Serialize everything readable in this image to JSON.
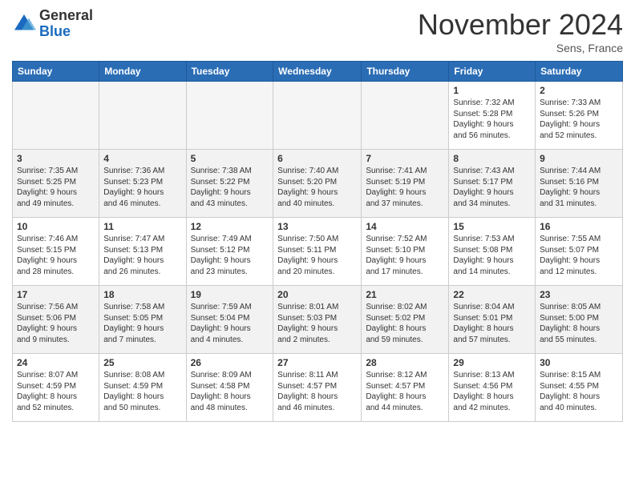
{
  "logo": {
    "general": "General",
    "blue": "Blue"
  },
  "header": {
    "month": "November 2024",
    "location": "Sens, France"
  },
  "weekdays": [
    "Sunday",
    "Monday",
    "Tuesday",
    "Wednesday",
    "Thursday",
    "Friday",
    "Saturday"
  ],
  "weeks": [
    [
      {
        "day": "",
        "info": ""
      },
      {
        "day": "",
        "info": ""
      },
      {
        "day": "",
        "info": ""
      },
      {
        "day": "",
        "info": ""
      },
      {
        "day": "",
        "info": ""
      },
      {
        "day": "1",
        "info": "Sunrise: 7:32 AM\nSunset: 5:28 PM\nDaylight: 9 hours\nand 56 minutes."
      },
      {
        "day": "2",
        "info": "Sunrise: 7:33 AM\nSunset: 5:26 PM\nDaylight: 9 hours\nand 52 minutes."
      }
    ],
    [
      {
        "day": "3",
        "info": "Sunrise: 7:35 AM\nSunset: 5:25 PM\nDaylight: 9 hours\nand 49 minutes."
      },
      {
        "day": "4",
        "info": "Sunrise: 7:36 AM\nSunset: 5:23 PM\nDaylight: 9 hours\nand 46 minutes."
      },
      {
        "day": "5",
        "info": "Sunrise: 7:38 AM\nSunset: 5:22 PM\nDaylight: 9 hours\nand 43 minutes."
      },
      {
        "day": "6",
        "info": "Sunrise: 7:40 AM\nSunset: 5:20 PM\nDaylight: 9 hours\nand 40 minutes."
      },
      {
        "day": "7",
        "info": "Sunrise: 7:41 AM\nSunset: 5:19 PM\nDaylight: 9 hours\nand 37 minutes."
      },
      {
        "day": "8",
        "info": "Sunrise: 7:43 AM\nSunset: 5:17 PM\nDaylight: 9 hours\nand 34 minutes."
      },
      {
        "day": "9",
        "info": "Sunrise: 7:44 AM\nSunset: 5:16 PM\nDaylight: 9 hours\nand 31 minutes."
      }
    ],
    [
      {
        "day": "10",
        "info": "Sunrise: 7:46 AM\nSunset: 5:15 PM\nDaylight: 9 hours\nand 28 minutes."
      },
      {
        "day": "11",
        "info": "Sunrise: 7:47 AM\nSunset: 5:13 PM\nDaylight: 9 hours\nand 26 minutes."
      },
      {
        "day": "12",
        "info": "Sunrise: 7:49 AM\nSunset: 5:12 PM\nDaylight: 9 hours\nand 23 minutes."
      },
      {
        "day": "13",
        "info": "Sunrise: 7:50 AM\nSunset: 5:11 PM\nDaylight: 9 hours\nand 20 minutes."
      },
      {
        "day": "14",
        "info": "Sunrise: 7:52 AM\nSunset: 5:10 PM\nDaylight: 9 hours\nand 17 minutes."
      },
      {
        "day": "15",
        "info": "Sunrise: 7:53 AM\nSunset: 5:08 PM\nDaylight: 9 hours\nand 14 minutes."
      },
      {
        "day": "16",
        "info": "Sunrise: 7:55 AM\nSunset: 5:07 PM\nDaylight: 9 hours\nand 12 minutes."
      }
    ],
    [
      {
        "day": "17",
        "info": "Sunrise: 7:56 AM\nSunset: 5:06 PM\nDaylight: 9 hours\nand 9 minutes."
      },
      {
        "day": "18",
        "info": "Sunrise: 7:58 AM\nSunset: 5:05 PM\nDaylight: 9 hours\nand 7 minutes."
      },
      {
        "day": "19",
        "info": "Sunrise: 7:59 AM\nSunset: 5:04 PM\nDaylight: 9 hours\nand 4 minutes."
      },
      {
        "day": "20",
        "info": "Sunrise: 8:01 AM\nSunset: 5:03 PM\nDaylight: 9 hours\nand 2 minutes."
      },
      {
        "day": "21",
        "info": "Sunrise: 8:02 AM\nSunset: 5:02 PM\nDaylight: 8 hours\nand 59 minutes."
      },
      {
        "day": "22",
        "info": "Sunrise: 8:04 AM\nSunset: 5:01 PM\nDaylight: 8 hours\nand 57 minutes."
      },
      {
        "day": "23",
        "info": "Sunrise: 8:05 AM\nSunset: 5:00 PM\nDaylight: 8 hours\nand 55 minutes."
      }
    ],
    [
      {
        "day": "24",
        "info": "Sunrise: 8:07 AM\nSunset: 4:59 PM\nDaylight: 8 hours\nand 52 minutes."
      },
      {
        "day": "25",
        "info": "Sunrise: 8:08 AM\nSunset: 4:59 PM\nDaylight: 8 hours\nand 50 minutes."
      },
      {
        "day": "26",
        "info": "Sunrise: 8:09 AM\nSunset: 4:58 PM\nDaylight: 8 hours\nand 48 minutes."
      },
      {
        "day": "27",
        "info": "Sunrise: 8:11 AM\nSunset: 4:57 PM\nDaylight: 8 hours\nand 46 minutes."
      },
      {
        "day": "28",
        "info": "Sunrise: 8:12 AM\nSunset: 4:57 PM\nDaylight: 8 hours\nand 44 minutes."
      },
      {
        "day": "29",
        "info": "Sunrise: 8:13 AM\nSunset: 4:56 PM\nDaylight: 8 hours\nand 42 minutes."
      },
      {
        "day": "30",
        "info": "Sunrise: 8:15 AM\nSunset: 4:55 PM\nDaylight: 8 hours\nand 40 minutes."
      }
    ]
  ]
}
